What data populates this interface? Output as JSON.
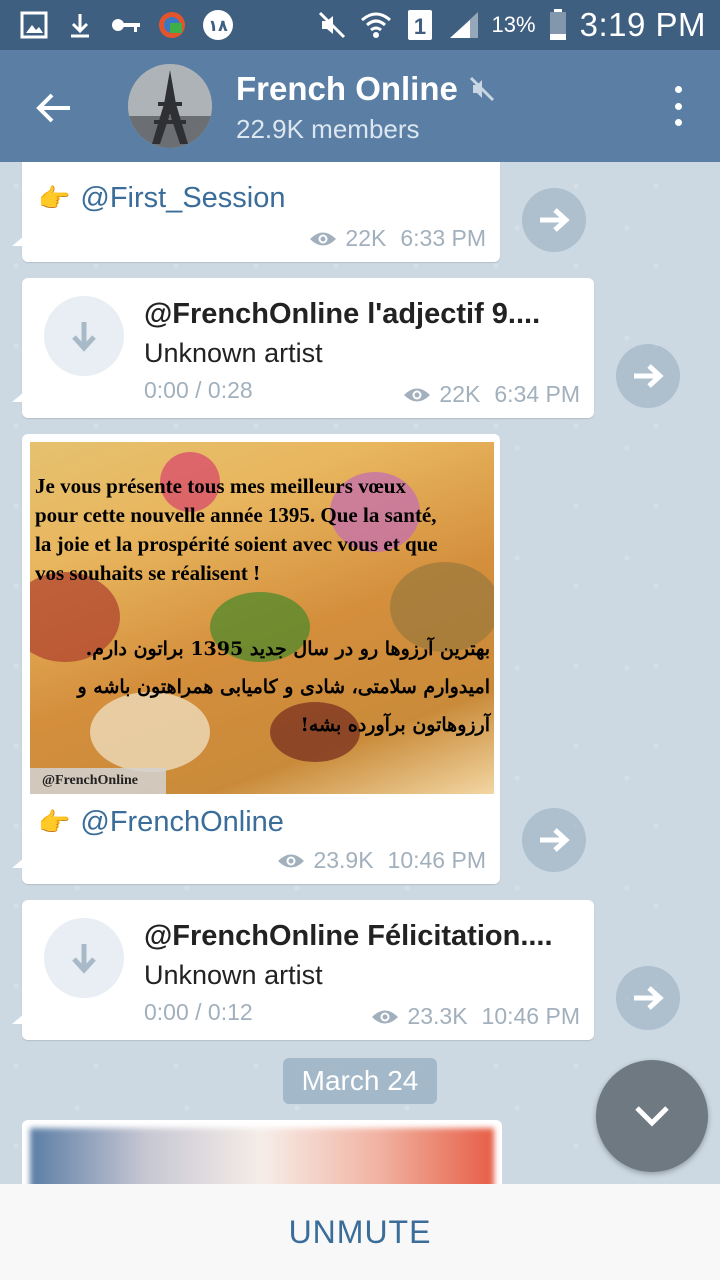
{
  "status_bar": {
    "battery_percent": "13%",
    "time": "3:19 PM",
    "sim_slot": "1",
    "icons": [
      "gallery-icon",
      "download-icon",
      "key-icon",
      "vpn-icon",
      "persian-18-icon",
      "mute-icon",
      "wifi-icon",
      "sim-icon",
      "signal-icon",
      "battery-icon"
    ]
  },
  "header": {
    "title": "French Online",
    "members": "22.9K members",
    "muted": true
  },
  "messages": [
    {
      "type": "link",
      "text": "@First_Session",
      "views": "22K",
      "time": "6:33 PM"
    },
    {
      "type": "audio",
      "title": "@FrenchOnline l'adjectif 9....",
      "artist": "Unknown artist",
      "duration": "0:00 / 0:28",
      "views": "22K",
      "time": "6:34 PM"
    },
    {
      "type": "photo",
      "image_text_fr": [
        "Je vous présente tous mes meilleurs vœux",
        "pour cette nouvelle année 1395. Que la santé,",
        "la joie et la prospérité soient avec vous et que",
        "vos souhaits se réalisent !"
      ],
      "image_text_fa": [
        "بهترین آرزوها رو در سال جدید 1395 براتون دارم.",
        "امیدوارم سلامتی، شادی و کامیابی همراهتون باشه و",
        "آرزوهاتون برآورده بشه!"
      ],
      "watermark": "@FrenchOnline",
      "caption": "@FrenchOnline",
      "views": "23.9K",
      "time": "10:46 PM"
    },
    {
      "type": "audio",
      "title": "@FrenchOnline Félicitation....",
      "artist": "Unknown artist",
      "duration": "0:00 / 0:12",
      "views": "23.3K",
      "time": "10:46 PM"
    }
  ],
  "date_separator": "March 24",
  "bottom_bar": {
    "action": "UNMUTE"
  },
  "colors": {
    "status_bar": "#3f5f80",
    "header": "#5a7ea4",
    "chat_bg": "#ccd9e3",
    "link": "#3a6d99",
    "meta": "#a2b0bd"
  }
}
